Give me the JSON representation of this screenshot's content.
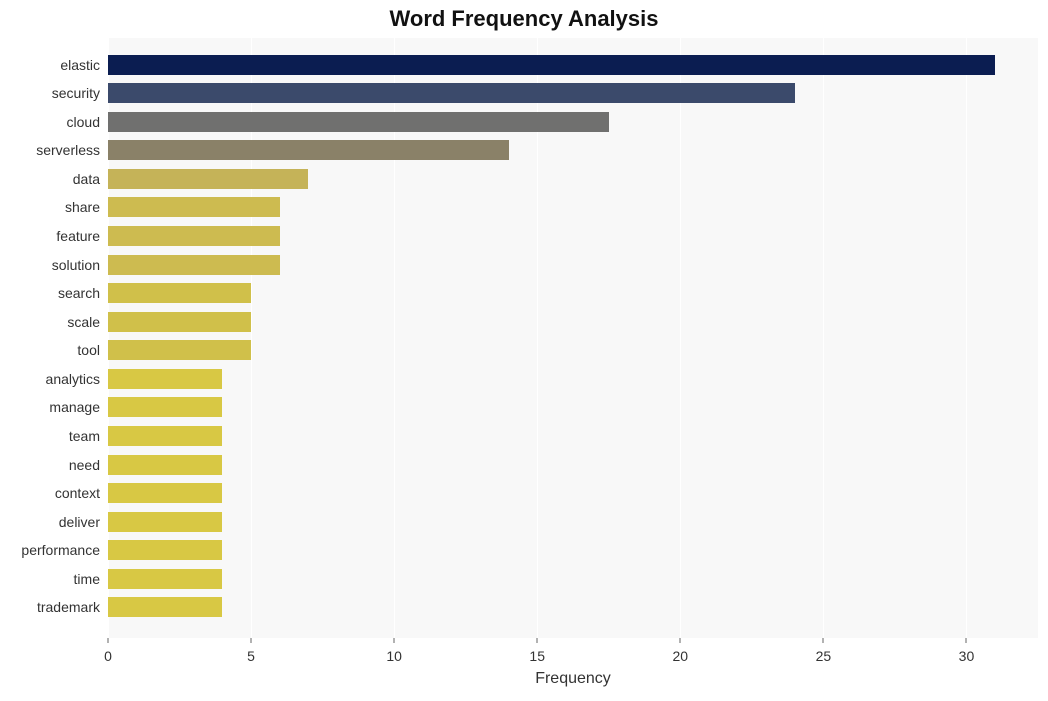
{
  "chart_data": {
    "type": "bar",
    "orientation": "horizontal",
    "title": "Word Frequency Analysis",
    "xlabel": "Frequency",
    "ylabel": "",
    "xlim": [
      0,
      32.5
    ],
    "xticks": [
      0,
      5,
      10,
      15,
      20,
      25,
      30
    ],
    "categories": [
      "elastic",
      "security",
      "cloud",
      "serverless",
      "data",
      "share",
      "feature",
      "solution",
      "search",
      "scale",
      "tool",
      "analytics",
      "manage",
      "team",
      "need",
      "context",
      "deliver",
      "performance",
      "time",
      "trademark"
    ],
    "values": [
      31,
      24,
      17.5,
      14,
      7,
      6,
      6,
      6,
      5,
      5,
      5,
      4,
      4,
      4,
      4,
      4,
      4,
      4,
      4,
      4
    ],
    "colors": [
      "#0b1d51",
      "#3b4a6b",
      "#70706f",
      "#8a8168",
      "#c5b358",
      "#cdbb50",
      "#cdbb50",
      "#cdbb50",
      "#d0c04a",
      "#d0c04a",
      "#d0c04a",
      "#d8c844",
      "#d8c844",
      "#d8c844",
      "#d8c844",
      "#d8c844",
      "#d8c844",
      "#d8c844",
      "#d8c844",
      "#d8c844"
    ]
  }
}
